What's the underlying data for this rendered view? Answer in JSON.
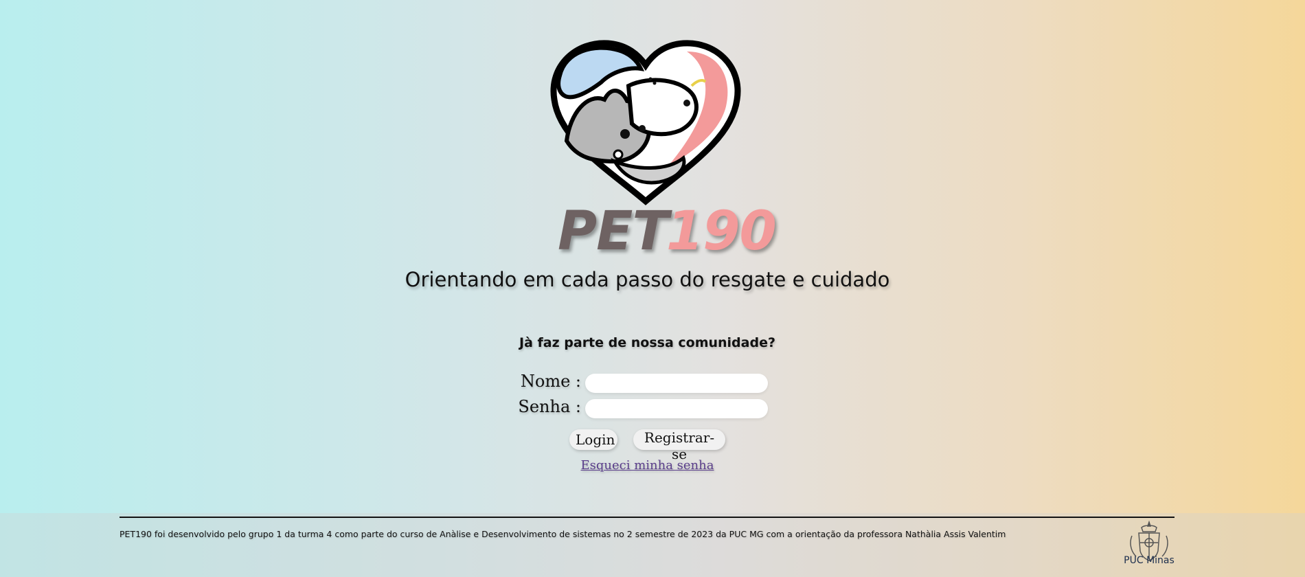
{
  "brand": {
    "word1": "PET",
    "word2": "190"
  },
  "tagline": "Orientando em cada passo do resgate e cuidado",
  "login": {
    "question": "Jà faz parte de nossa comunidade?",
    "name_label": "Nome :",
    "name_value": "",
    "password_label": "Senha :",
    "password_value": "",
    "login_button": "Login",
    "register_button": "Registrar-se",
    "forgot_link": "Esqueci minha senha"
  },
  "footer": {
    "text": "PET190 foi desenvolvido pelo grupo 1 da turma 4 como parte do curso de Anàlise e Desenvolvimento de sistemas no 2 semestre de 2023 da PUC MG com a orientação da professora Nathàlia Assis Valentim",
    "university_name": "PUC Minas"
  },
  "icons": {
    "logo": "heart-dog-cat-logo-icon",
    "university": "puc-minas-crest-icon"
  },
  "colors": {
    "brand_gray": "#6e6262",
    "brand_pink": "#f39a9a",
    "link": "#5a3e8b",
    "gradient_left": "#b9eeee",
    "gradient_right": "#f5d79a"
  }
}
